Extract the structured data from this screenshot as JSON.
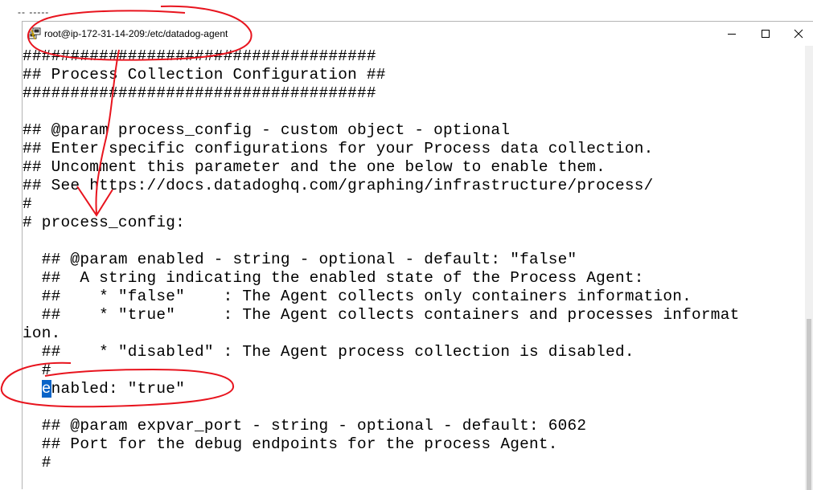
{
  "top_scrap_text": "-- -----",
  "window": {
    "title": "root@ip-172-31-14-209:/etc/datadog-agent",
    "icons": {
      "app": "putty-icon",
      "minimize": "minimize-icon",
      "maximize": "maximize-icon",
      "close": "close-icon"
    },
    "controls": {
      "minimize": "—",
      "maximize": "☐",
      "close": "✕"
    }
  },
  "terminal": {
    "lines": [
      "#####################################",
      "## Process Collection Configuration ##",
      "#####################################",
      "",
      "## @param process_config - custom object - optional",
      "## Enter specific configurations for your Process data collection.",
      "## Uncomment this parameter and the one below to enable them.",
      "## See https://docs.datadoghq.com/graphing/infrastructure/process/",
      "#",
      "# process_config:",
      "",
      "  ## @param enabled - string - optional - default: \"false\"",
      "  ##  A string indicating the enabled state of the Process Agent:",
      "  ##    * \"false\"    : The Agent collects only containers information.",
      "  ##    * \"true\"     : The Agent collects containers and processes informat",
      "ion.",
      "  ##    * \"disabled\" : The Agent process collection is disabled.",
      "  #",
      "",
      "",
      "  ## @param expvar_port - string - optional - default: 6062",
      "  ## Port for the debug endpoints for the process Agent.",
      "  #"
    ],
    "enabled_line": {
      "indent": "  ",
      "cursor_char": "e",
      "rest": "nabled: \"true\""
    }
  },
  "colors": {
    "annotation": "#e8141e",
    "cursor": "#0a64c8"
  }
}
